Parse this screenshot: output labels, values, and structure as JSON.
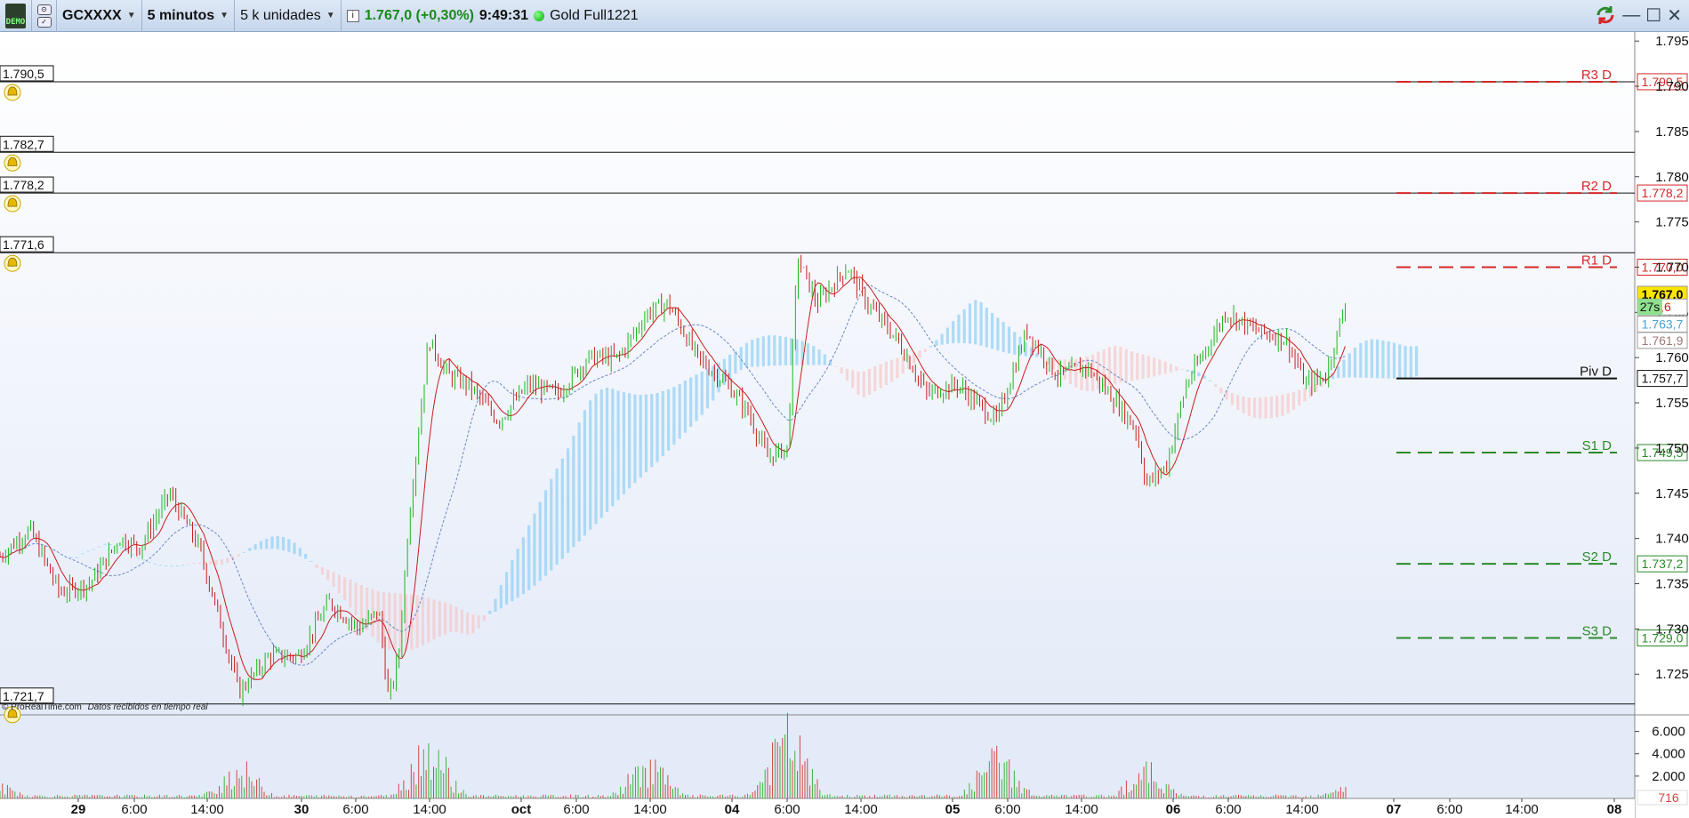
{
  "toolbar": {
    "badge": "DEMO",
    "ticker": "GCXXXX",
    "timeframe": "5 minutos",
    "units": "5 k unidades",
    "info_icon": "i",
    "price": "1.767,0 (+0,30%)",
    "time": "9:49:31",
    "status_label": "Gold Full1221",
    "minimize": "—",
    "maximize": "☐",
    "close": "✕"
  },
  "colors": {
    "up": "#1cb81c",
    "down": "#c81e1e",
    "resistance": "#d62728",
    "support": "#2a8a2a",
    "cloud_up": "#87cdf5",
    "cloud_down": "#f8c4c4",
    "background_top": "#ffffff",
    "background_bottom": "#e6ecf8"
  },
  "watermark": "© ProRealTime.com",
  "watermark_note": "Datos recibidos en tiempo real",
  "countdown": "27s",
  "chart_data": {
    "type": "candlestick",
    "ylim": [
      1720.5,
      1796.0
    ],
    "ytick_values": [
      1725,
      1730,
      1735,
      1740,
      1745,
      1750,
      1755,
      1760,
      1765,
      1770,
      1775,
      1780,
      1785,
      1790,
      1795
    ],
    "yticks": [
      "1.725",
      "1.730",
      "1.735",
      "1.740",
      "1.745",
      "1.750",
      "1.755",
      "1.760",
      "1.765",
      "1.770",
      "1.775",
      "1.780",
      "1.785",
      "1.790",
      "1.795"
    ],
    "xticks": [
      "29",
      "6:00",
      "14:00",
      "30",
      "6:00",
      "14:00",
      "oct",
      "6:00",
      "14:00",
      "04",
      "6:00",
      "14:00",
      "05",
      "6:00",
      "14:00",
      "06",
      "6:00",
      "14:00",
      "07",
      "6:00",
      "14:00",
      "08"
    ],
    "xtick_bold": [
      true,
      false,
      false,
      true,
      false,
      false,
      true,
      false,
      false,
      true,
      false,
      false,
      true,
      false,
      false,
      true,
      false,
      false,
      true,
      false,
      false,
      true
    ],
    "price_path": [
      [
        0,
        1738
      ],
      [
        3,
        1741
      ],
      [
        6,
        1734
      ],
      [
        9,
        1735
      ],
      [
        12,
        1740
      ],
      [
        14,
        1739
      ],
      [
        17,
        1745
      ],
      [
        20,
        1739
      ],
      [
        21,
        1735
      ],
      [
        24,
        1723
      ],
      [
        27,
        1727
      ],
      [
        30,
        1727
      ],
      [
        33,
        1733
      ],
      [
        36,
        1730
      ],
      [
        38,
        1732
      ],
      [
        39,
        1722
      ],
      [
        40,
        1727
      ],
      [
        41,
        1742
      ],
      [
        43,
        1762
      ],
      [
        45,
        1758
      ],
      [
        47,
        1757
      ],
      [
        50,
        1753
      ],
      [
        53,
        1757
      ],
      [
        56,
        1756
      ],
      [
        59,
        1760
      ],
      [
        62,
        1760
      ],
      [
        65,
        1765
      ],
      [
        67,
        1766
      ],
      [
        70,
        1760
      ],
      [
        73,
        1757
      ],
      [
        75,
        1754
      ],
      [
        77,
        1749
      ],
      [
        79,
        1750
      ],
      [
        80,
        1771
      ],
      [
        82,
        1766
      ],
      [
        85,
        1770
      ],
      [
        87,
        1766
      ],
      [
        90,
        1762
      ],
      [
        93,
        1756
      ],
      [
        96,
        1757
      ],
      [
        100,
        1753
      ],
      [
        103,
        1763
      ],
      [
        106,
        1758
      ],
      [
        109,
        1759
      ],
      [
        112,
        1755
      ],
      [
        114,
        1752
      ],
      [
        115,
        1746
      ],
      [
        117,
        1748
      ],
      [
        119,
        1757
      ],
      [
        121,
        1761
      ],
      [
        123,
        1765
      ],
      [
        126,
        1763
      ],
      [
        129,
        1762
      ],
      [
        131,
        1757
      ],
      [
        133,
        1758
      ],
      [
        135,
        1766
      ]
    ],
    "levels": [
      {
        "name": "R3 D",
        "value": 1790.5,
        "label": "1.790,5",
        "style": "resistance"
      },
      {
        "name": "R2 D",
        "value": 1778.2,
        "label": "1.778,2",
        "style": "resistance"
      },
      {
        "name": "R1 D",
        "value": 1770.0,
        "label": "1.770,0",
        "style": "resistance"
      },
      {
        "name": "Piv D",
        "value": 1757.7,
        "label": "1.757,7",
        "style": "pivot"
      },
      {
        "name": "S1 D",
        "value": 1749.5,
        "label": "1.749,5",
        "style": "support"
      },
      {
        "name": "S2 D",
        "value": 1737.2,
        "label": "1.737,2",
        "style": "support"
      },
      {
        "name": "S3 D",
        "value": 1729.0,
        "label": "1.729,0",
        "style": "support"
      }
    ],
    "alert_lines": [
      {
        "value": 1790.5,
        "label": "1.790,5"
      },
      {
        "value": 1782.7,
        "label": "1.782,7"
      },
      {
        "value": 1778.2,
        "label": "1.778,2"
      },
      {
        "value": 1771.6,
        "label": "1.771,6"
      },
      {
        "value": 1721.7,
        "label": "1.721,7"
      }
    ],
    "right_labels": [
      {
        "value": 1767.0,
        "label": "1.767,0",
        "bg": "#ffe600",
        "fg": "#000"
      },
      {
        "value": 1765.6,
        "label": "5,6",
        "bg": "#ffffff",
        "fg": "#c81e1e"
      },
      {
        "value": 1763.7,
        "label": "1.763,7",
        "bg": "#ffffff",
        "fg": "#4aa3d6"
      },
      {
        "value": 1761.9,
        "label": "1.761,9",
        "bg": "#ffffff",
        "fg": "#a07878"
      }
    ],
    "volume": {
      "ylim": [
        0,
        7000
      ],
      "ytick_values": [
        2000,
        4000,
        6000
      ],
      "yticks": [
        "2.000",
        "4.000",
        "6.000"
      ],
      "current": "716",
      "peaks": [
        [
          0,
          1200
        ],
        [
          24,
          3200
        ],
        [
          43,
          5800
        ],
        [
          65,
          3800
        ],
        [
          79,
          6800
        ],
        [
          100,
          4400
        ],
        [
          115,
          3000
        ],
        [
          135,
          1400
        ]
      ]
    }
  }
}
